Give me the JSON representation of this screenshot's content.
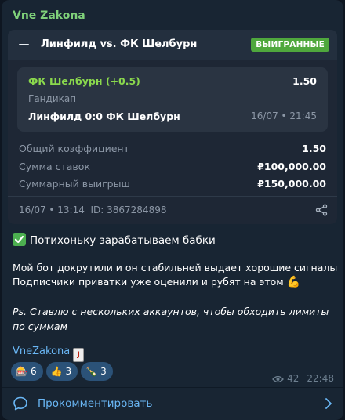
{
  "channel": {
    "name": "Vne Zakona"
  },
  "bet_card": {
    "match_title": "Линфилд vs. ФК Шелбурн",
    "status_badge": "ВЫИГРАННЫЕ",
    "selection": "ФК Шелбурн (+0.5)",
    "odds": "1.50",
    "market": "Гандикап",
    "event": "Линфилд 0:0 ФК Шелбурн",
    "event_time": "16/07 • 21:45",
    "summary": [
      {
        "label": "Общий коэффициент",
        "value": "1.50"
      },
      {
        "label": "Сумма ставок",
        "value": "₽100,000.00"
      },
      {
        "label": "Суммарный выигрыш",
        "value": "₽150,000.00"
      }
    ],
    "footer": "16/07 • 13:14  ID: 3867284898"
  },
  "post": {
    "title": "Потихоньку зарабатываем бабки",
    "line1": "Мой бот докрутили и он стабильней выдает хорошие сигналы",
    "line2": "Подписчики приватки уже оценили и рубят на этом",
    "line2_emoji": "💪",
    "note": "Ps. Ставлю с нескольких аккаунтов, чтобы обходить лимиты по суммам",
    "signature": "VneZakona"
  },
  "reactions": [
    {
      "icon": "slot-machine-icon",
      "glyph": "🎰",
      "count": "6"
    },
    {
      "icon": "thumbs-up-icon",
      "glyph": "👍",
      "count": "3"
    },
    {
      "icon": "champagne-icon",
      "glyph": "🍾",
      "count": "3"
    }
  ],
  "meta": {
    "views": "42",
    "time": "22:48"
  },
  "comment": {
    "label": "Прокомментировать"
  },
  "colors": {
    "background": "#0e1621",
    "bubble": "#182533",
    "accent_green": "#7fd17a",
    "badge_green": "#4fa83d",
    "link_blue": "#6ab7f5"
  }
}
